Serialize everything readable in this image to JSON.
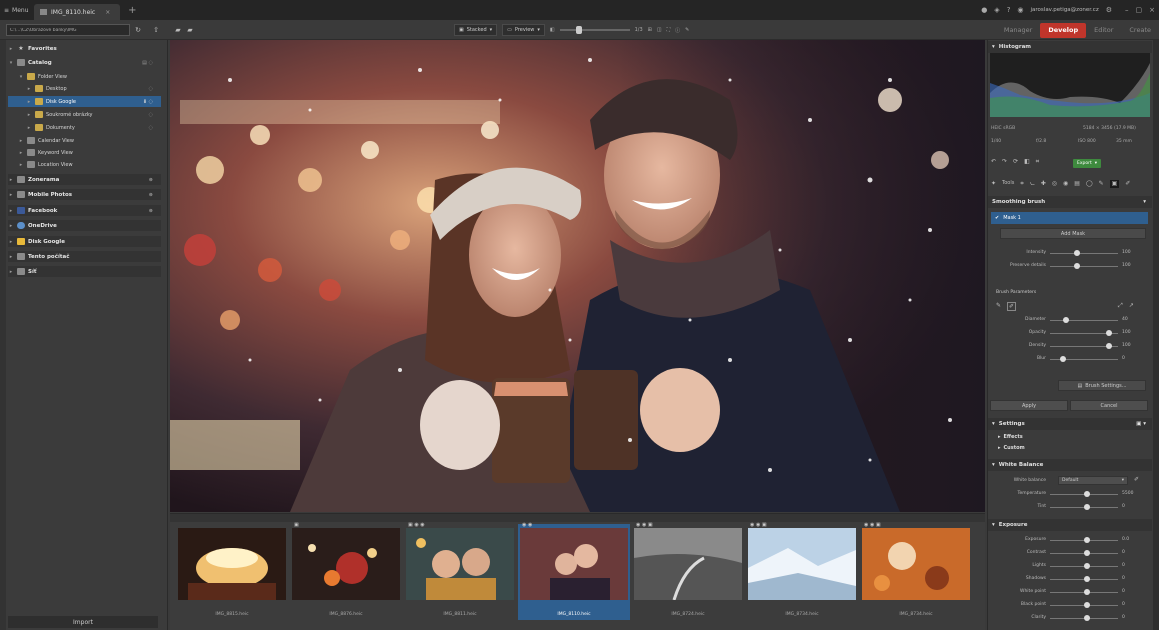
{
  "titlebar": {
    "menu_label": "Menu",
    "tab_label": "IMG_8110.heic",
    "account": "jaroslav.petiga@zoner.cz"
  },
  "toolbar": {
    "path_value": "C:\\...\\CZ\\Obrazové banky\\IMG",
    "view_label": "Stacked",
    "preview_label": "Preview",
    "zoom_label": "1/3",
    "modules": [
      "Manager",
      "Develop",
      "Editor",
      "Create"
    ],
    "active_module": "Develop"
  },
  "navigator": {
    "items": [
      {
        "label": "Favorites",
        "bold": true,
        "icon": "star-icon"
      },
      {
        "label": "Catalog",
        "bold": true,
        "icon": "catalog-icon"
      },
      {
        "label": "Folder View",
        "icon": "folder-icon"
      },
      {
        "label": "Desktop",
        "icon": "folder-icon"
      },
      {
        "label": "Disk Google",
        "icon": "folder-icon",
        "selected": true
      },
      {
        "label": "Soukromé obrázky",
        "icon": "folder-icon"
      },
      {
        "label": "Dokumenty",
        "icon": "folder-icon"
      },
      {
        "label": "Calendar View",
        "icon": "calendar-icon"
      },
      {
        "label": "Keyword View",
        "icon": "keyword-icon"
      },
      {
        "label": "Location View",
        "icon": "location-icon"
      },
      {
        "label": "Zonerama",
        "bold": true,
        "icon": "cloud-icon",
        "section": true
      },
      {
        "label": "Mobile Photos",
        "bold": true,
        "icon": "phone-icon",
        "section": true
      },
      {
        "label": "Facebook",
        "bold": true,
        "icon": "facebook-icon",
        "section": true
      },
      {
        "label": "OneDrive",
        "bold": true,
        "icon": "onedrive-icon",
        "section": true
      },
      {
        "label": "Disk Google",
        "bold": true,
        "icon": "drive-icon",
        "section": true
      },
      {
        "label": "Tento počítač",
        "bold": true,
        "icon": "computer-icon",
        "section": true
      },
      {
        "label": "Síť",
        "bold": true,
        "icon": "network-icon",
        "section": true
      }
    ],
    "import_label": "Import"
  },
  "filmstrip": {
    "thumbs": [
      {
        "name": "IMG_8815.heic"
      },
      {
        "name": "IMG_8876.heic"
      },
      {
        "name": "IMG_8811.heic"
      },
      {
        "name": "IMG_8110.heic",
        "selected": true
      },
      {
        "name": "IMG_8724.heic"
      },
      {
        "name": "IMG_8734.heic"
      },
      {
        "name": "IMG_8734.heic"
      }
    ]
  },
  "right_panel": {
    "histogram_title": "Histogram",
    "image_info_left": "HEIC   sRGB",
    "image_info_right": "5184 × 3456 (17.9 MB)",
    "exif": [
      "1/40",
      "f/2.8",
      "ISO 800",
      "35 mm"
    ],
    "export_label": "Export",
    "tools_label": "Tools",
    "brush_title": "Smoothing brush",
    "mask_label": "Mask 1",
    "add_mask_label": "Add Mask",
    "mask_sliders": [
      {
        "label": "Intensity",
        "value": "100"
      },
      {
        "label": "Preserve details",
        "value": "100"
      }
    ],
    "brush_params_title": "Brush Parameters",
    "brush_sliders": [
      {
        "label": "Diameter",
        "value": "40"
      },
      {
        "label": "Opacity",
        "value": "100"
      },
      {
        "label": "Density",
        "value": "100"
      },
      {
        "label": "Blur",
        "value": "0"
      }
    ],
    "brush_settings_label": "Brush Settings...",
    "apply_label": "Apply",
    "cancel_label": "Cancel",
    "settings_title": "Settings",
    "effects_label": "Effects",
    "custom_label": "Custom",
    "wb_title": "White Balance",
    "wb_mode_label": "White balance",
    "wb_mode_value": "Default",
    "wb_sliders": [
      {
        "label": "Temperature",
        "value": "5500"
      },
      {
        "label": "Tint",
        "value": "0"
      }
    ],
    "exposure_title": "Exposure",
    "exposure_sliders": [
      {
        "label": "Exposure",
        "value": "0.0"
      },
      {
        "label": "Contrast",
        "value": "0"
      },
      {
        "label": "Lights",
        "value": "0"
      },
      {
        "label": "Shadows",
        "value": "0"
      },
      {
        "label": "White point",
        "value": "0"
      },
      {
        "label": "Black point",
        "value": "0"
      },
      {
        "label": "Clarity",
        "value": "0"
      }
    ]
  },
  "colors": {
    "accent": "#c0352b",
    "selection": "#2f5f8f",
    "export_green": "#3e8a3e"
  }
}
